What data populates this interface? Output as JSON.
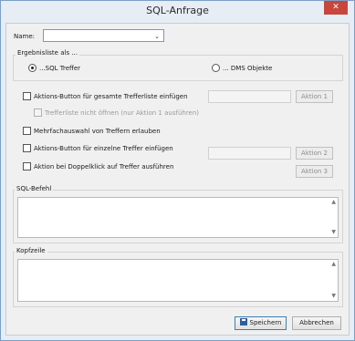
{
  "window": {
    "title": "SQL-Anfrage",
    "close_glyph": "✕"
  },
  "name_field": {
    "label": "Name:",
    "value": ""
  },
  "result_group": {
    "title": "Ergebnisliste als ...",
    "options": [
      {
        "label": "...SQL Treffer",
        "checked": true
      },
      {
        "label": "... DMS Objekte",
        "checked": false
      }
    ]
  },
  "options": {
    "action_button_all": "Aktions-Button für gesamte Trefferliste einfügen",
    "dont_open_list": "Trefferliste nicht öffnen (nur Aktion 1 ausführen)",
    "multi_select": "Mehrfachauswahl von Treffern erlauben",
    "action_button_single": "Aktions-Button für einzelne Treffer einfügen",
    "double_click_action": "Aktion bei Doppelklick auf Treffer ausführen"
  },
  "action_buttons": {
    "action1": "Aktion 1",
    "action2": "Aktion 2",
    "action3": "Aktion 3"
  },
  "sql_group": {
    "title": "SQL-Befehl",
    "value": ""
  },
  "header_group": {
    "title": "Kopfzeile",
    "value": ""
  },
  "footer": {
    "save_label": "Speichern",
    "cancel_label": "Abbrechen"
  },
  "colors": {
    "window_border": "#7c9fc7",
    "close_button": "#c8463d",
    "dialog_bg": "#f0f0f0"
  }
}
